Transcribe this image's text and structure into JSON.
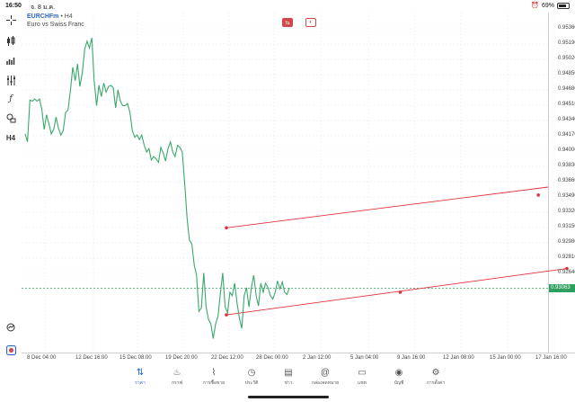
{
  "status_bar": {
    "time": "16:50",
    "date": "จ. 8 ม.ค.",
    "battery": "69%",
    "battery_level": 0.69
  },
  "symbol": {
    "name": "EURCHFm",
    "timeframe": "• H4",
    "description": "Euro vs Swiss Franc"
  },
  "toolbar": {
    "timeframe_label": "H4",
    "items": [
      "crosshair-icon",
      "candle-type-icon",
      "bar-chart-icon",
      "indicators-icon",
      "function-icon",
      "objects-icon",
      "timeframe-icon"
    ]
  },
  "chart_data": {
    "type": "line",
    "title": "",
    "price_labels": [
      "0.95360",
      "0.95190",
      "0.95020",
      "0.94850",
      "0.94680",
      "0.94510",
      "0.94340",
      "0.94170",
      "0.94000",
      "0.93830",
      "0.93660",
      "0.93490",
      "0.93320",
      "0.93150",
      "0.92980",
      "0.92810",
      "0.92640"
    ],
    "current_price": "0.93063",
    "time_labels": [
      "8 Dec 04:00",
      "12 Dec 16:00",
      "15 Dec 08:00",
      "19 Dec 20:00",
      "22 Dec 12:00",
      "28 Dec 00:00",
      "2 Jan 12:00",
      "5 Jan 04:00",
      "9 Jan 16:00",
      "12 Jan 08:00",
      "15 Jan 00:00",
      "17 Jan 16:00"
    ],
    "ylim": [
      0.9256,
      0.9545
    ],
    "series": [
      {
        "values": [
          0.9443,
          0.9436,
          0.9473,
          0.9472,
          0.9474,
          0.9472,
          0.9474,
          0.9465,
          0.9447,
          0.946,
          0.9452,
          0.9443,
          0.9447,
          0.9458,
          0.9448,
          0.9442,
          0.9446,
          0.9462,
          0.9464,
          0.9481,
          0.9502,
          0.949,
          0.9505,
          0.9485,
          0.9497,
          0.9518,
          0.9525,
          0.9519,
          0.9528,
          0.949,
          0.9468,
          0.9486,
          0.9476,
          0.9488,
          0.948,
          0.9485,
          0.9486,
          0.9484,
          0.9466,
          0.9482,
          0.9472,
          0.9468,
          0.9468,
          0.947,
          0.9462,
          0.9446,
          0.944,
          0.9442,
          0.9438,
          0.9442,
          0.9433,
          0.9427,
          0.943,
          0.942,
          0.9423,
          0.9421,
          0.9418,
          0.9431,
          0.9426,
          0.9419,
          0.943,
          0.9436,
          0.9427,
          0.9423,
          0.9433,
          0.9431,
          0.9427,
          0.94,
          0.9369,
          0.9349,
          0.9346,
          0.9327,
          0.9318,
          0.9286,
          0.9289,
          0.932,
          0.929,
          0.9279,
          0.9275,
          0.9262,
          0.9275,
          0.9282,
          0.9302,
          0.932,
          0.929,
          0.9285,
          0.9303,
          0.93,
          0.9311,
          0.9293,
          0.928,
          0.9271,
          0.93,
          0.9307,
          0.929,
          0.9307,
          0.9318,
          0.93,
          0.9291,
          0.9311,
          0.9303,
          0.9311,
          0.9307,
          0.93,
          0.9297,
          0.9303,
          0.9313,
          0.9306,
          0.9312,
          0.9303,
          0.9301,
          0.9307
        ]
      }
    ],
    "trendlines": [
      {
        "name": "upper-trendline",
        "points": [
          [
            0,
            0.936
          ],
          [
            131,
            0.9389
          ],
          [
            180,
            0.9408
          ]
        ]
      },
      {
        "name": "lower-trendline",
        "points": [
          [
            0,
            0.9283
          ],
          [
            73,
            0.9303
          ],
          [
            143,
            0.9324
          ]
        ]
      }
    ],
    "line_color": "#3aa86b",
    "trendline_color": "#e0323a",
    "current_price_color": "#2f9f5e",
    "grid": true
  },
  "nav": {
    "items": [
      {
        "label": "ราคา",
        "icon": "quotes-icon",
        "active": true
      },
      {
        "label": "กราฟ",
        "icon": "chart-icon",
        "active": false
      },
      {
        "label": "การซื้อขาย",
        "icon": "trade-icon",
        "active": false
      },
      {
        "label": "ประวัติ",
        "icon": "history-icon",
        "active": false
      },
      {
        "label": "ข่าว",
        "icon": "news-icon",
        "active": false
      },
      {
        "label": "กล่องจดหมาย",
        "icon": "mailbox-icon",
        "active": false
      },
      {
        "label": "แชท",
        "icon": "chat-icon",
        "active": false
      },
      {
        "label": "บัญชี",
        "icon": "account-icon",
        "active": false
      },
      {
        "label": "การตั้งค่า",
        "icon": "settings-icon",
        "active": false
      }
    ]
  }
}
